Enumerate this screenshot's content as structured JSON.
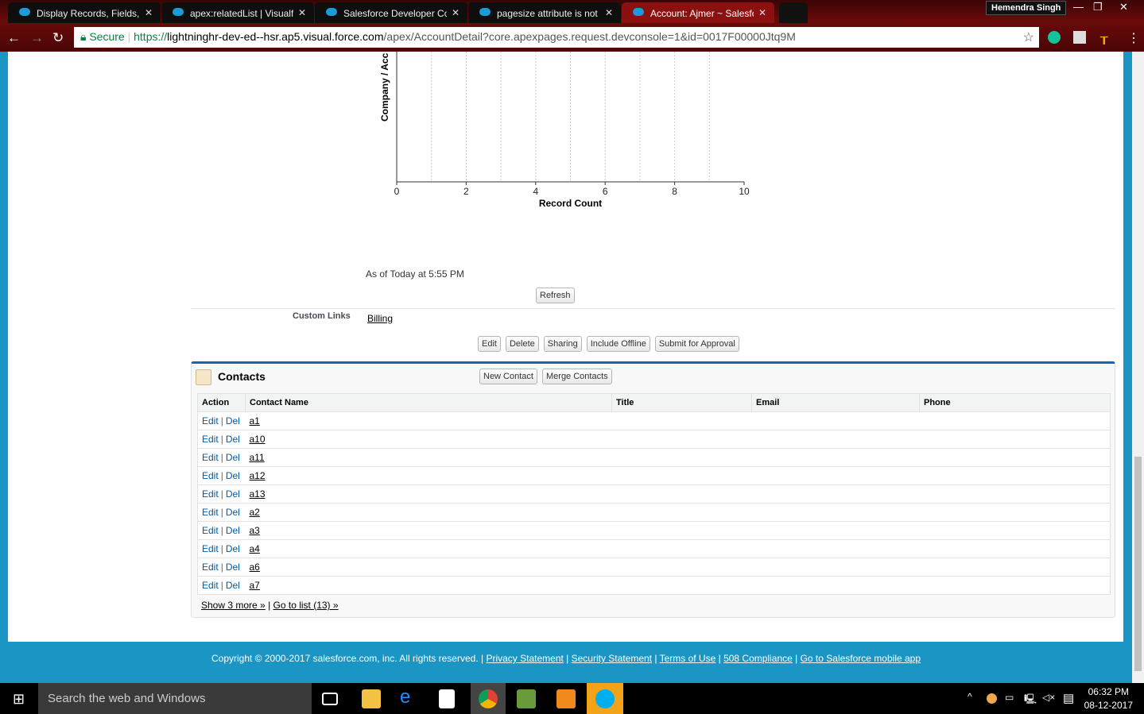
{
  "browser": {
    "tabs": [
      {
        "title": "Display Records, Fields, a",
        "active": false
      },
      {
        "title": "apex:relatedList | Visualfo",
        "active": false
      },
      {
        "title": "Salesforce Developer Con",
        "active": false
      },
      {
        "title": "pagesize attribute is not",
        "active": false
      },
      {
        "title": "Account: Ajmer ~ Salesfo",
        "active": true
      }
    ],
    "close_glyph": "✕",
    "user": "Hemendra Singh",
    "secure_label": "Secure",
    "url_scheme": "https://",
    "url_host": "lightninghr-dev-ed--hsr.ap5.visual.force.com",
    "url_path": "/apex/AccountDetail?core.apexpages.request.devconsole=1&id=0017F00000Jtq9M"
  },
  "chart_data": {
    "type": "bar",
    "orientation": "horizontal",
    "xlabel": "Record Count",
    "ylabel": "Company / Acc",
    "xlim": [
      0,
      10
    ],
    "xticks": [
      "0",
      "2",
      "4",
      "6",
      "8",
      "10"
    ],
    "grid": true,
    "categories": [],
    "values": []
  },
  "report": {
    "as_of": "As of Today at 5:55 PM",
    "refresh": "Refresh"
  },
  "custom_links": {
    "label": "Custom Links",
    "billing": "Billing"
  },
  "detail_buttons": [
    "Edit",
    "Delete",
    "Sharing",
    "Include Offline",
    "Submit for Approval"
  ],
  "contacts": {
    "title": "Contacts",
    "new_contact": "New Contact",
    "merge_contacts": "Merge Contacts",
    "columns": [
      "Action",
      "Contact Name",
      "Title",
      "Email",
      "Phone"
    ],
    "edit": "Edit",
    "del": "Del",
    "sep": "|",
    "rows": [
      "a1",
      "a10",
      "a11",
      "a12",
      "a13",
      "a2",
      "a3",
      "a4",
      "a6",
      "a7"
    ],
    "show_more": "Show 3 more »",
    "go_to_list": "Go to list (13) »"
  },
  "footer": {
    "copyright": "Copyright © 2000-2017 salesforce.com, inc. All rights reserved. |",
    "links": [
      "Privacy Statement",
      "Security Statement",
      "Terms of Use",
      "508 Compliance",
      "Go to Salesforce mobile app"
    ]
  },
  "taskbar": {
    "search": "Search the web and Windows",
    "time": "06:32 PM",
    "date": "08-12-2017"
  }
}
